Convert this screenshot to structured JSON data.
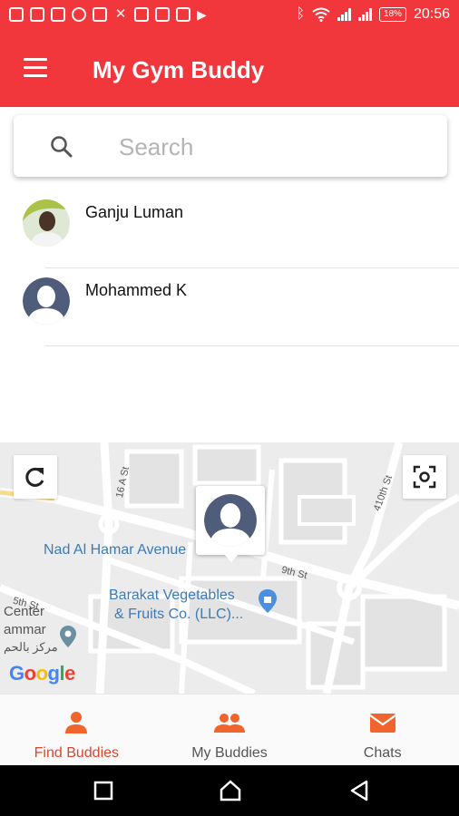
{
  "status_bar": {
    "battery": "18%",
    "time": "20:56"
  },
  "app_bar": {
    "title": "My Gym Buddy"
  },
  "search": {
    "placeholder": "Search",
    "value": ""
  },
  "buddies": [
    {
      "name": "Ganju Luman",
      "avatar": "photo-avatar"
    },
    {
      "name": "Mohammed K",
      "avatar": "default-avatar"
    }
  ],
  "map": {
    "labels": {
      "avenue": "Nad Al Hamar Avenue",
      "street_9th": "9th St",
      "street_16a": "16 A St",
      "street_410th": "410th St",
      "street_5th": "5th St",
      "poi_line1": "Barakat Vegetables",
      "poi_line2": "& Fruits Co. (LLC)...",
      "center": "Center",
      "ammar": "ammar",
      "arabic": "مركز بالحم",
      "google": "Google"
    },
    "colors": {
      "road": "#ffffff",
      "block": "#e4e4e4",
      "highway": "#f6dc8c",
      "label_blue": "#3d7ab8"
    }
  },
  "bottom_nav": {
    "items": [
      {
        "label": "Find Buddies",
        "icon": "person-icon",
        "active": true
      },
      {
        "label": "My Buddies",
        "icon": "people-icon",
        "active": false
      },
      {
        "label": "Chats",
        "icon": "mail-icon",
        "active": false
      }
    ],
    "active_color": "#e0442c",
    "icon_color": "#f0642e"
  },
  "colors": {
    "primary": "#f2373c",
    "avatar_bg": "#4f5d7a"
  }
}
